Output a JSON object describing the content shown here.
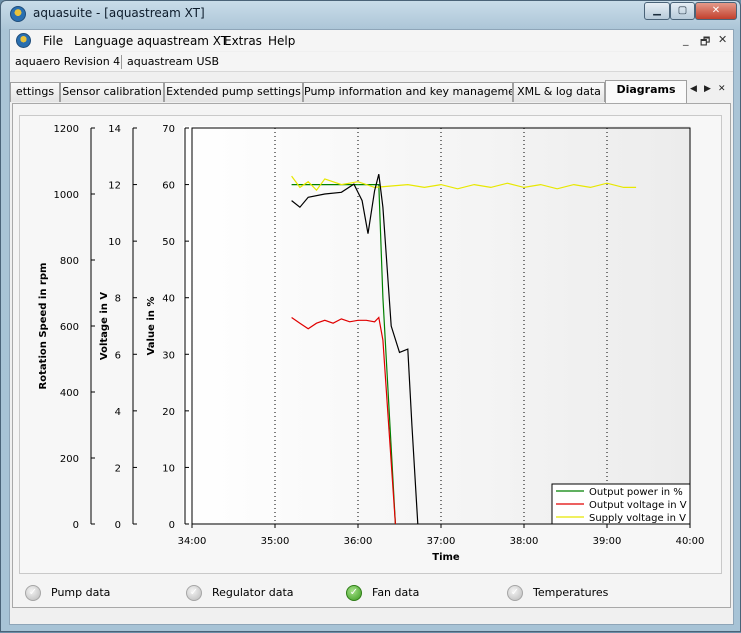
{
  "window": {
    "title": "aquasuite - [aquastream XT]",
    "controls": {
      "minimize": "▁",
      "maximize": "▢",
      "close": "✕"
    }
  },
  "menu": {
    "items": [
      "File",
      "Language",
      "aquastream XT",
      "Extras",
      "Help"
    ],
    "mdi_buttons": [
      "_",
      "🗗",
      "✕"
    ]
  },
  "devices": [
    "aquaero Revision 4",
    "aquastream USB"
  ],
  "tabs": {
    "items": [
      "ettings",
      "Sensor calibration",
      "Extended pump settings",
      "Pump information and key management",
      "XML & log data",
      "Diagrams"
    ],
    "active": "Diagrams",
    "scroll_left": "◀",
    "scroll_right": "▶",
    "close": "✕"
  },
  "chart_data": {
    "type": "line",
    "xlabel": "Time",
    "x_ticks": [
      "34:00",
      "35:00",
      "36:00",
      "37:00",
      "38:00",
      "39:00",
      "40:00"
    ],
    "xlim_minutes": [
      34,
      40
    ],
    "axes": [
      {
        "label": "Rotation Speed in rpm",
        "ylim": [
          0,
          1200
        ],
        "ticks": [
          "1200",
          "1000",
          "800",
          "600",
          "400",
          "200",
          "0"
        ]
      },
      {
        "label": "Voltage in V",
        "ylim": [
          0,
          14
        ],
        "ticks": [
          "14",
          "12",
          "10",
          "8",
          "6",
          "4",
          "2",
          "0"
        ]
      },
      {
        "label": "Value in %",
        "ylim": [
          0,
          70
        ],
        "ticks": [
          "70",
          "60",
          "50",
          "40",
          "30",
          "20",
          "10",
          "0"
        ]
      }
    ],
    "grid": "vertical dotted",
    "legend_position": "bottom-right",
    "series": [
      {
        "name": "Output power in %",
        "color": "#008000",
        "axis": "Value in %",
        "x": [
          35.2,
          36.0,
          36.25,
          36.3,
          36.45
        ],
        "y": [
          60,
          60,
          60,
          40,
          0
        ]
      },
      {
        "name": "Output voltage in V",
        "color": "#e00000",
        "axis": "Voltage in V",
        "x": [
          35.2,
          35.3,
          35.4,
          35.5,
          35.6,
          35.7,
          35.8,
          35.9,
          36.0,
          36.1,
          36.2,
          36.25,
          36.3,
          36.45
        ],
        "y": [
          7.3,
          7.1,
          6.9,
          7.1,
          7.2,
          7.1,
          7.25,
          7.15,
          7.2,
          7.2,
          7.15,
          7.3,
          6.5,
          0
        ]
      },
      {
        "name": "Supply voltage in V",
        "color": "#e8e800",
        "axis": "Voltage in V",
        "x": [
          35.2,
          35.3,
          35.4,
          35.5,
          35.6,
          35.8,
          36.0,
          36.2,
          36.4,
          36.6,
          36.8,
          37.0,
          37.2,
          37.4,
          37.6,
          37.8,
          38.0,
          38.2,
          38.4,
          38.6,
          38.8,
          39.0,
          39.2,
          39.35
        ],
        "y": [
          12.3,
          11.9,
          12.1,
          11.8,
          12.2,
          12.0,
          12.1,
          11.9,
          11.95,
          12.0,
          11.9,
          12.0,
          11.85,
          12.0,
          11.9,
          12.05,
          11.9,
          12.0,
          11.85,
          12.0,
          11.9,
          12.05,
          11.9,
          11.9
        ]
      },
      {
        "name": "Rotation Speed",
        "color": "#000000",
        "axis": "Rotation Speed in rpm",
        "x": [
          35.2,
          35.3,
          35.4,
          35.6,
          35.8,
          35.95,
          36.05,
          36.12,
          36.2,
          36.25,
          36.3,
          36.4,
          36.5,
          36.6,
          36.65,
          36.72
        ],
        "y": [
          980,
          960,
          990,
          1000,
          1005,
          1030,
          980,
          880,
          1010,
          1060,
          960,
          600,
          520,
          530,
          300,
          0
        ]
      }
    ]
  },
  "bottom_tabs": [
    {
      "label": "Pump data",
      "checked": false
    },
    {
      "label": "Regulator data",
      "checked": false
    },
    {
      "label": "Fan data",
      "checked": true
    },
    {
      "label": "Temperatures",
      "checked": false
    }
  ]
}
